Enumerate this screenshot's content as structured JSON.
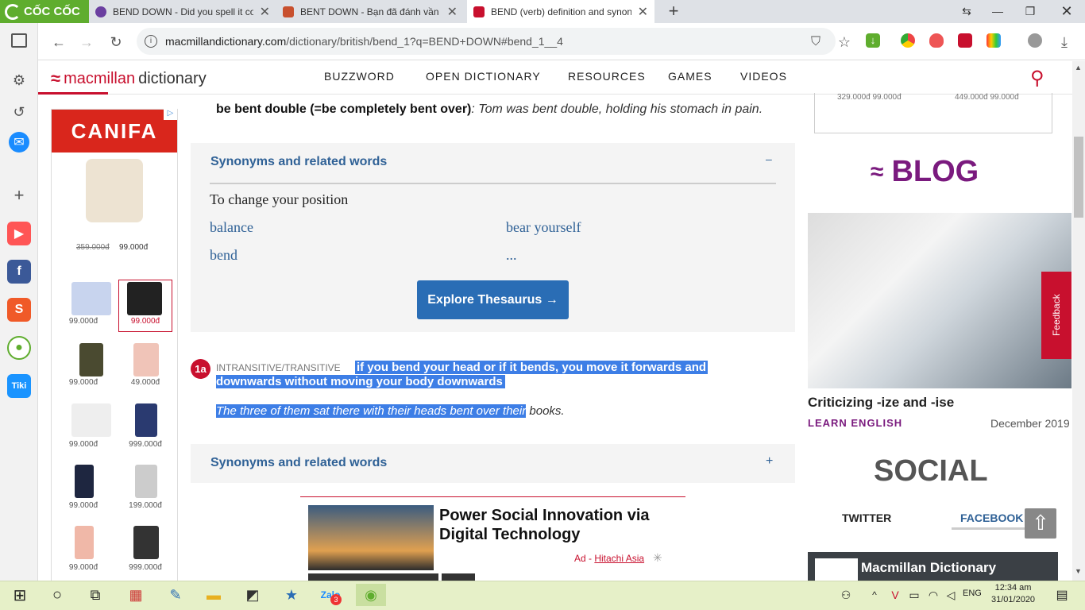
{
  "browser": {
    "brand": "CỐC CỐC",
    "tabs": [
      {
        "title": "BEND DOWN - Did you spell it cor"
      },
      {
        "title": "BENT DOWN - Bạn đã đánh vần đú"
      },
      {
        "title": "BEND (verb) definition and synony"
      }
    ],
    "url_domain": "macmillandictionary.com",
    "url_path": "/dictionary/british/bend_1?q=BEND+DOWN#bend_1__4"
  },
  "site": {
    "logo_brand": "macmillan",
    "logo_product": "dictionary",
    "nav": [
      "BUZZWORD",
      "OPEN DICTIONARY",
      "RESOURCES",
      "GAMES",
      "VIDEOS"
    ]
  },
  "ad_left": {
    "brand": "CANIFA",
    "hero_old_price": "359.000đ",
    "hero_price": "99.000đ",
    "prices": [
      "99.000đ",
      "99.000đ",
      "99.000đ",
      "49.000đ",
      "99.000đ",
      "999.000đ",
      "99.000đ",
      "199.000đ",
      "99.000đ",
      "999.000đ"
    ]
  },
  "entry": {
    "phrase": "be bent double (=be completely bent over)",
    "phrase_example": ": Tom was bent double, holding his stomach in pain.",
    "syn1_title": "Synonyms and related words",
    "syn1_toggle": "–",
    "syn1_group": "To change your position",
    "syn1_words": [
      "balance",
      "bear yourself",
      "bend",
      "..."
    ],
    "explore_label": "Explore Thesaurus →",
    "sense_number": "1a",
    "sense_grammar": "INTRANSITIVE/TRANSITIVE",
    "sense_definition_l1": "if you bend your head or if it bends, you move it forwards and",
    "sense_definition_l2": "downwards without moving your body downwards",
    "sense_example_hl": "The three of them sat there with their heads bent over their",
    "sense_example_rest": " books.",
    "syn2_title": "Synonyms and related words",
    "syn2_toggle": "+"
  },
  "ad_bottom": {
    "title": "Power Social Innovation via Digital Technology",
    "ad_label": "Ad - ",
    "advertiser": "Hitachi Asia"
  },
  "sidebar": {
    "top_prices": [
      "329.000đ  99.000đ",
      "449.000đ  99.000đ"
    ],
    "blog_heading": "BLOG",
    "blog_title": "Criticizing -ize and -ise",
    "blog_category": "LEARN ENGLISH",
    "blog_date": "December 2019",
    "social_heading": "SOCIAL",
    "twitter_tab": "TWITTER",
    "facebook_tab": "FACEBOOK",
    "fb_widget_title": "Macmillan Dictionary",
    "feedback_label": "Feedback"
  },
  "taskbar": {
    "language": "ENG",
    "time": "12:34 am",
    "date": "31/01/2020",
    "zalo_badge": "3"
  },
  "colors": {
    "brand_red": "#c8102e",
    "link_blue": "#2f6196",
    "blog_purple": "#7a1a7e",
    "selection": "#3d7ee6"
  }
}
